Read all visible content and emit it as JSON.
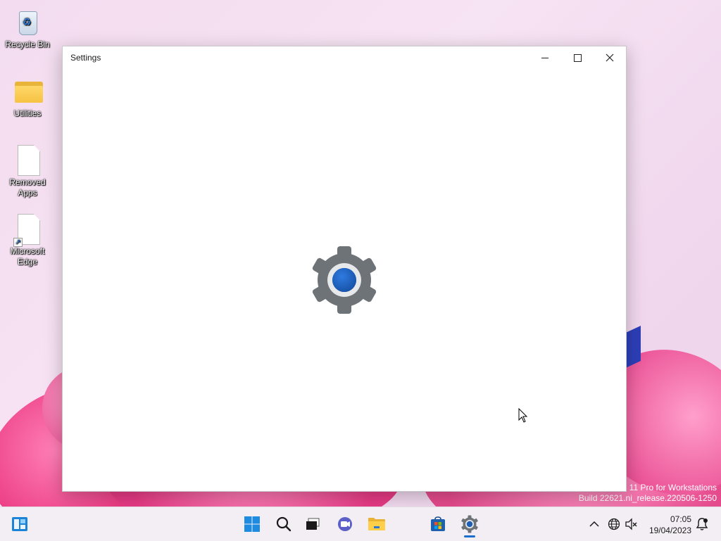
{
  "desktop": {
    "icons": [
      {
        "label": "Recycle Bin",
        "icon": "recycle-bin-icon"
      },
      {
        "label": "Utilities",
        "icon": "folder-icon"
      },
      {
        "label": "Removed Apps",
        "icon": "document-icon"
      },
      {
        "label": "Microsoft Edge",
        "icon": "shortcut-document-icon"
      }
    ],
    "watermark": {
      "line1": "s 11 Pro for Workstations",
      "line2": "Build 22621.ni_release.220506-1250"
    }
  },
  "window": {
    "title": "Settings",
    "controls": [
      "minimize",
      "maximize",
      "close"
    ],
    "content_icon": "settings-gear-icon"
  },
  "taskbar": {
    "widgets_icon": "widgets-icon",
    "pinned": [
      {
        "name": "start",
        "icon": "windows-logo-icon"
      },
      {
        "name": "search",
        "icon": "search-icon"
      },
      {
        "name": "task-view",
        "icon": "task-view-icon"
      },
      {
        "name": "chat",
        "icon": "teams-chat-icon"
      },
      {
        "name": "file-explorer",
        "icon": "folder-icon"
      },
      {
        "name": "store",
        "icon": "microsoft-store-icon"
      },
      {
        "name": "settings",
        "icon": "settings-gear-icon",
        "active": true
      }
    ],
    "tray": {
      "overflow_icon": "chevron-up-icon",
      "network_icon": "globe-icon",
      "volume_icon": "speaker-muted-icon",
      "time": "07:05",
      "date": "19/04/2023",
      "notification_icon": "notification-icon"
    }
  },
  "colors": {
    "accent": "#1a6ecc",
    "taskbar_bg": "#f3eef3",
    "bloom_pink": "#e63a84"
  }
}
